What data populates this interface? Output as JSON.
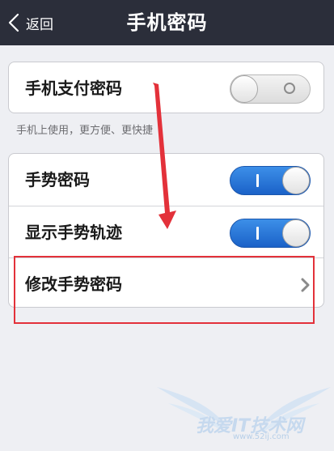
{
  "nav": {
    "back_label": "返回",
    "title": "手机密码"
  },
  "settings": {
    "payment_password": {
      "label": "手机支付密码",
      "enabled": false
    },
    "hint": "手机上使用，更方便、更快捷",
    "gesture_password": {
      "label": "手势密码",
      "enabled": true
    },
    "show_gesture_trace": {
      "label": "显示手势轨迹",
      "enabled": true
    },
    "change_gesture_password": {
      "label": "修改手势密码"
    }
  },
  "watermark": {
    "text": "我爱IT技术网",
    "url": "www.52ij.com"
  },
  "colors": {
    "navbar": "#2b2e3a",
    "toggle_on": "#2a78dc",
    "highlight": "#e3313a"
  }
}
